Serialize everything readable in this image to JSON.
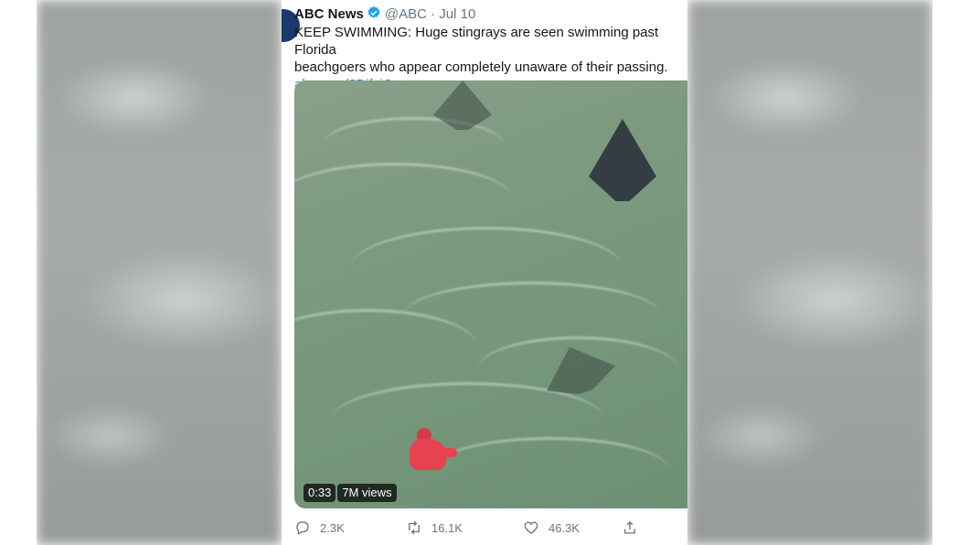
{
  "tweet": {
    "author_name": "ABC News",
    "handle": "@ABC",
    "separator": "·",
    "date": "Jul 10",
    "text_line1": "KEEP SWIMMING: Huge stingrays are seen swimming past Florida",
    "text_line2": "beachgoers who appear completely unaware of their passing.",
    "link": "abcn.ws/2DjfvjQ",
    "video": {
      "duration": "0:33",
      "views": "7M views"
    },
    "actions": {
      "replies": "2.3K",
      "retweets": "16.1K",
      "likes": "46.3K"
    }
  },
  "icons": [
    "verified-icon",
    "reply-icon",
    "retweet-icon",
    "like-icon",
    "share-icon"
  ],
  "colors": {
    "link": "#1b95e0",
    "verified": "#1da1f2",
    "muted": "#657786"
  }
}
